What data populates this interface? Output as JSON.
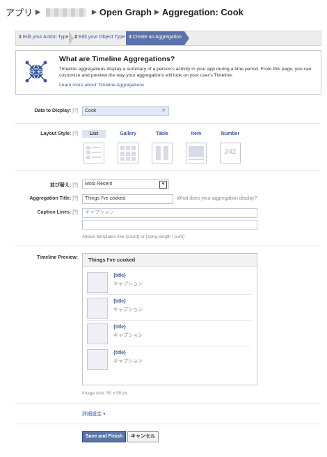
{
  "header": {
    "app_label": "アプリ",
    "crumb_open_graph": "Open Graph",
    "page_title": "Aggregation: Cook"
  },
  "steps": [
    {
      "num": "1",
      "label": "Edit your Action Type"
    },
    {
      "num": "2",
      "label": "Edit your Object Type"
    },
    {
      "num": "3",
      "label": "Create an Aggregation"
    }
  ],
  "info": {
    "title": "What are Timeline Aggregations?",
    "text": "Timeline aggregations display a summary of a person's activity in your app during a time period. From this page, you can customize and preview the way your aggregations will look on your user's Timeline.",
    "link": "Learn more about Timeline Aggregations"
  },
  "form": {
    "help": "[?]",
    "data_to_display": {
      "label": "Data to Display:",
      "value": "Cook"
    },
    "layout_style": {
      "label": "Layout Style:",
      "options": [
        "List",
        "Gallery",
        "Table",
        "Item",
        "Number"
      ],
      "selected": "List",
      "number_thumb": "242"
    },
    "sort": {
      "label": "並び替え:",
      "value": "Most Recent"
    },
    "aggregation_title": {
      "label": "Aggregation Title:",
      "value": "Things I've cooked",
      "hint": "What does your aggregation display?"
    },
    "caption_lines": {
      "label": "Caption Lines:",
      "line1_placeholder": "キャプション",
      "hint": "Allows templates like {count} or {song.length | sum}"
    }
  },
  "preview": {
    "label": "Timeline Preview:",
    "header": "Things I've cooked",
    "items": [
      {
        "title": "{title}",
        "caption": "キャプション"
      },
      {
        "title": "{title}",
        "caption": "キャプション"
      },
      {
        "title": "{title}",
        "caption": "キャプション"
      },
      {
        "title": "{title}",
        "caption": "キャプション"
      }
    ],
    "image_size": "Image size: 50 x 50 px"
  },
  "advanced_link": "詳細設定",
  "buttons": {
    "save": "Save and Finish",
    "cancel": "キャンセル"
  },
  "colors": {
    "link": "#3b5998",
    "primary_button": "#5b74a8"
  }
}
